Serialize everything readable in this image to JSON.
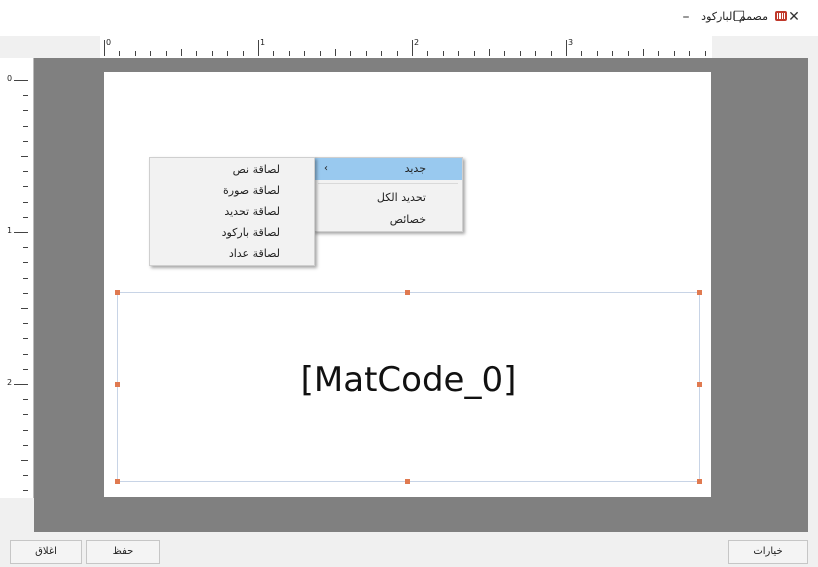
{
  "window": {
    "title": "مصمم الباركود",
    "controls": {
      "minimize": "–",
      "maximize": "☐",
      "close": "✕"
    }
  },
  "ruler": {
    "horizontal_labels": [
      "0",
      "1",
      "2",
      "3"
    ],
    "vertical_labels": [
      "0",
      "1",
      "2"
    ]
  },
  "canvas": {
    "label_text": "[MatCode_0]"
  },
  "context_menu": {
    "items": [
      {
        "label": "جديد",
        "has_submenu": true,
        "selected": true
      },
      {
        "label": "تحديد الكل"
      },
      {
        "label": "خصائص"
      }
    ],
    "arrow": "›"
  },
  "submenu": {
    "items": [
      {
        "label": "لصاقة نص"
      },
      {
        "label": "لصاقة صورة"
      },
      {
        "label": "لصاقة تحديد"
      },
      {
        "label": "لصاقة باركود"
      },
      {
        "label": "لصاقة عداد"
      }
    ]
  },
  "footer": {
    "close_label": "اغلاق",
    "save_label": "حفظ",
    "options_label": "خيارات"
  },
  "colors": {
    "canvas_bg": "#808080",
    "menu_selected": "#99c9ef",
    "handle": "#e07a50",
    "icon_red": "#c0392b"
  }
}
